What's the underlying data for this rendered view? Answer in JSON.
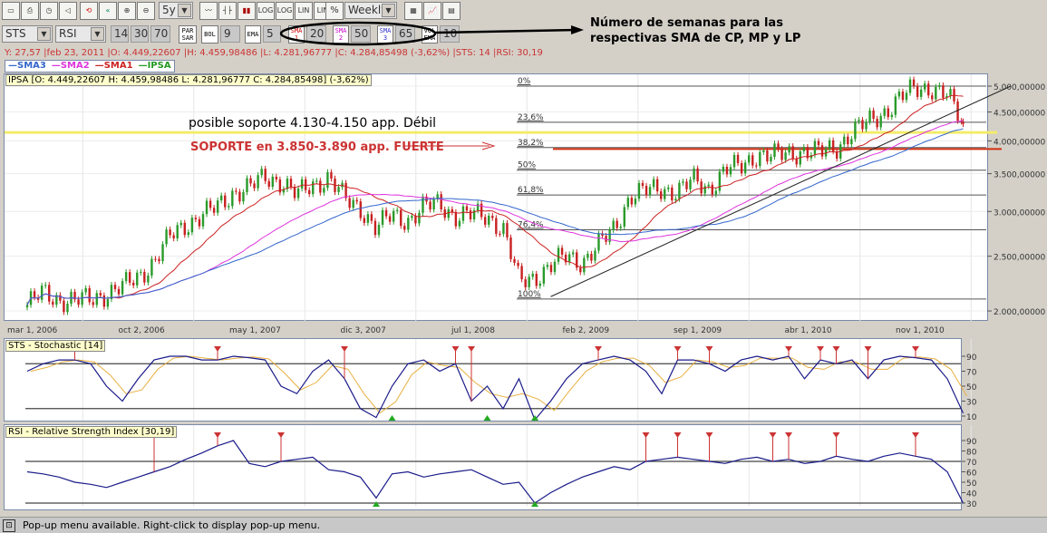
{
  "toolbar": {
    "period": "5y",
    "interval": "Weekly",
    "scale_buttons": [
      "LOG",
      "LOG",
      "LIN",
      "LIN",
      "%"
    ],
    "indicator1": "STS",
    "indicator2": "RSI",
    "params": [
      "14",
      "30",
      "70"
    ],
    "parsar": "PAR SAR",
    "bol": "BOL",
    "bol_value": "9",
    "ema": "EMA",
    "ema_value": "5",
    "sma1": "SMA 1",
    "sma1_value": "20",
    "sma2": "SMA 2",
    "sma2_value": "50",
    "sma3": "SMA 3",
    "sma3_value": "65",
    "volema": "VOL EMA",
    "volema_value": "10"
  },
  "info_line": "Y: 27,57 |feb 23, 2011 |O: 4.449,22607 |H: 4.459,98486 |L: 4.281,96777 |C: 4.284,85498 (-3,62%) |STS: 14 |RSI: 30,19",
  "legend": [
    {
      "label": "SMA3",
      "color": "#3366cc"
    },
    {
      "label": "SMA2",
      "color": "#dd33dd"
    },
    {
      "label": "SMA1",
      "color": "#cc2222"
    },
    {
      "label": "IPSA",
      "color": "#229922"
    }
  ],
  "ipsa_tag": "IPSA [O: 4.449,22607  H: 4.459,98486  L: 4.281,96777  C: 4.284,85498] (-3,62%)",
  "annotations": {
    "weak_support": "posible soporte 4.130-4.150 app. Débil",
    "strong_support": "SOPORTE en 3.850-3.890 app. FUERTE",
    "sma_note_line1": "Número de semanas para las",
    "sma_note_line2": "respectivas SMA de CP, MP y LP"
  },
  "status_bar": "Pop-up menu available. Right-click to display pop-up menu.",
  "chart_data": [
    {
      "type": "candlestick",
      "title": "IPSA",
      "frequency_of_control_points": "monthly",
      "x_labels": [
        {
          "label": "mar 1, 2006",
          "month": 0
        },
        {
          "label": "oct 2, 2006",
          "month": 7
        },
        {
          "label": "may 1, 2007",
          "month": 14
        },
        {
          "label": "dic 3, 2007",
          "month": 21
        },
        {
          "label": "jul 1, 2008",
          "month": 28
        },
        {
          "label": "feb 2, 2009",
          "month": 35
        },
        {
          "label": "sep 1, 2009",
          "month": 42
        },
        {
          "label": "abr 1, 2010",
          "month": 49
        },
        {
          "label": "nov 1, 2010",
          "month": 56
        }
      ],
      "y_ticks": [
        {
          "v": 5000,
          "label": "5.000,00000"
        },
        {
          "v": 4500,
          "label": "4.500,00000"
        },
        {
          "v": 4000,
          "label": "4.000,00000"
        },
        {
          "v": 3500,
          "label": "3.500,00000"
        },
        {
          "v": 3000,
          "label": "3.000,00000"
        },
        {
          "v": 2500,
          "label": "2.500,00000"
        },
        {
          "v": 2000,
          "label": "2.000,00000"
        }
      ],
      "scale": "log",
      "monthly_close": [
        2050,
        2150,
        2100,
        2080,
        2100,
        2150,
        2200,
        2300,
        2450,
        2700,
        2850,
        2950,
        3050,
        3250,
        3300,
        3450,
        3400,
        3200,
        3350,
        3450,
        3150,
        3050,
        2800,
        2950,
        2900,
        3050,
        3100,
        2950,
        2950,
        2950,
        2800,
        2250,
        2300,
        2400,
        2500,
        2450,
        2600,
        2800,
        3200,
        3250,
        3300,
        3250,
        3400,
        3300,
        3550,
        3600,
        3800,
        3750,
        3800,
        3850,
        3800,
        3900,
        4150,
        4300,
        4500,
        4750,
        4950,
        4980,
        4800,
        4285
      ],
      "sma_periods_weeks": [
        20,
        50,
        65
      ],
      "fibonacci": {
        "high": 5000,
        "low": 2100,
        "levels": [
          {
            "pct": 0,
            "label": "0%"
          },
          {
            "pct": 23.6,
            "label": "23,6%"
          },
          {
            "pct": 38.2,
            "label": "38,2%"
          },
          {
            "pct": 50,
            "label": "50%"
          },
          {
            "pct": 61.8,
            "label": "61,8%"
          },
          {
            "pct": 76.4,
            "label": "76,4%"
          },
          {
            "pct": 100,
            "label": "100%"
          }
        ]
      },
      "support_weak": 4140,
      "support_strong": 3870,
      "trendline": [
        {
          "month": 33,
          "v": 2120
        },
        {
          "month": 62,
          "v": 5000
        }
      ]
    },
    {
      "type": "line",
      "title": "STS - Stochastic [14]",
      "y_ticks": [
        90,
        70,
        50,
        30,
        10
      ],
      "bands": [
        80,
        20
      ],
      "values": [
        70,
        80,
        85,
        85,
        80,
        50,
        30,
        60,
        85,
        90,
        90,
        85,
        85,
        90,
        88,
        85,
        50,
        40,
        70,
        85,
        60,
        20,
        8,
        50,
        80,
        85,
        70,
        80,
        30,
        50,
        20,
        60,
        5,
        30,
        60,
        80,
        85,
        90,
        85,
        70,
        40,
        85,
        85,
        80,
        70,
        85,
        90,
        85,
        90,
        60,
        85,
        80,
        85,
        60,
        85,
        90,
        88,
        85,
        60,
        14
      ],
      "sell_signals": [
        3,
        12,
        20,
        27,
        28,
        36,
        41,
        43,
        48,
        50,
        51,
        53,
        56
      ],
      "buy_signals": [
        23,
        29,
        32
      ]
    },
    {
      "type": "line",
      "title": "RSI - Relative Strength Index [30,19]",
      "y_ticks": [
        90,
        80,
        70,
        60,
        50,
        40,
        30
      ],
      "bands": [
        70,
        30
      ],
      "values": [
        60,
        58,
        55,
        50,
        48,
        45,
        50,
        55,
        60,
        65,
        72,
        78,
        85,
        90,
        68,
        65,
        70,
        72,
        74,
        62,
        60,
        55,
        35,
        58,
        60,
        55,
        58,
        60,
        62,
        55,
        48,
        50,
        30,
        40,
        48,
        55,
        60,
        65,
        62,
        70,
        72,
        74,
        72,
        70,
        68,
        72,
        74,
        70,
        72,
        68,
        70,
        75,
        72,
        70,
        75,
        78,
        75,
        72,
        60,
        30
      ],
      "sell_signals": [
        8,
        12,
        16,
        39,
        41,
        43,
        47,
        48,
        51,
        56
      ],
      "buy_signals": [
        22,
        32
      ]
    }
  ]
}
